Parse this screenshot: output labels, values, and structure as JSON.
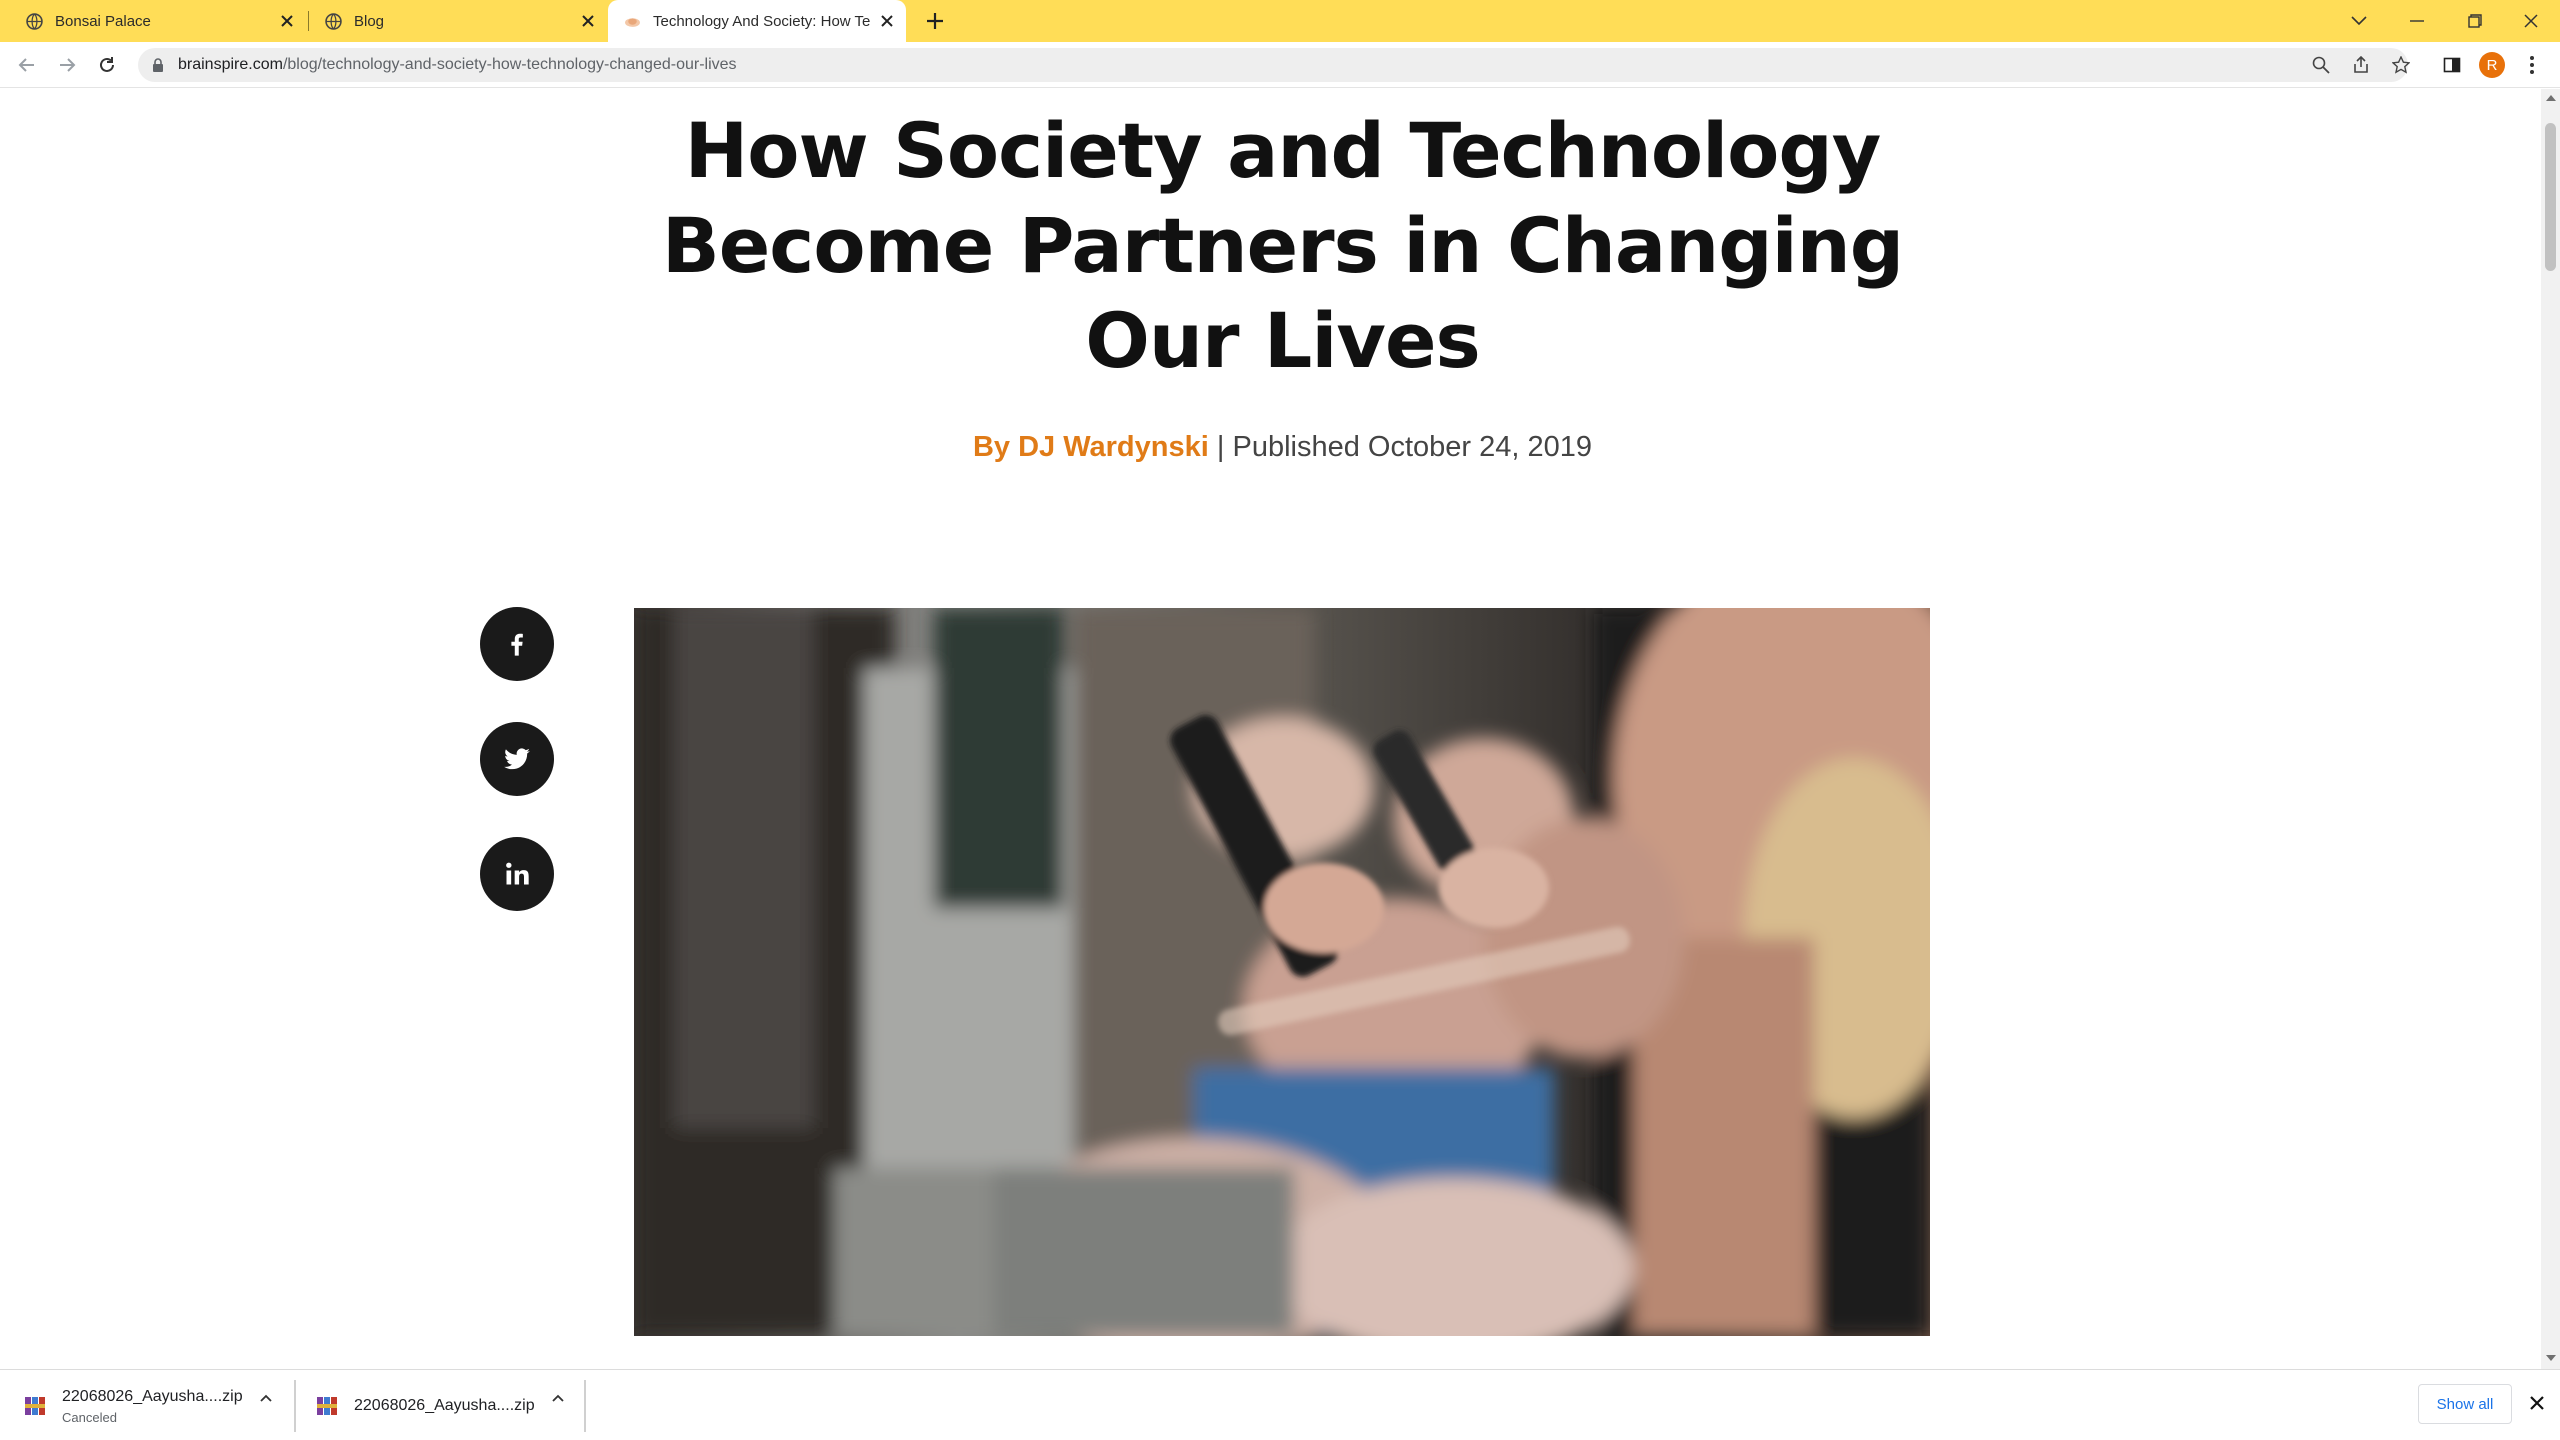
{
  "browser": {
    "tabs": [
      {
        "title": "Bonsai Palace",
        "favicon": "globe-icon",
        "active": false
      },
      {
        "title": "Blog",
        "favicon": "globe-icon",
        "active": false
      },
      {
        "title": "Technology And Society: How Te",
        "favicon": "site-logo-icon",
        "active": true
      }
    ],
    "new_tab_icon": "plus-icon",
    "url_host": "brainspire.com",
    "url_path": "/blog/technology-and-society-how-technology-changed-our-lives",
    "avatar_letter": "R",
    "accent_color": "#ffdd57"
  },
  "article": {
    "title": "How Society and Technology Become Partners in Changing Our Lives",
    "author": "By DJ Wardynski",
    "separator": "|",
    "published": "Published October 24, 2019",
    "author_color": "#e07b17",
    "hero_image_description_icon": "photo"
  },
  "share": [
    {
      "network": "facebook",
      "icon": "facebook-icon"
    },
    {
      "network": "twitter",
      "icon": "twitter-icon"
    },
    {
      "network": "linkedin",
      "icon": "linkedin-icon"
    }
  ],
  "downloads": {
    "items": [
      {
        "name": "22068026_Aayusha....zip",
        "status": "Canceled"
      },
      {
        "name": "22068026_Aayusha....zip",
        "status": ""
      }
    ],
    "show_all": "Show all"
  }
}
